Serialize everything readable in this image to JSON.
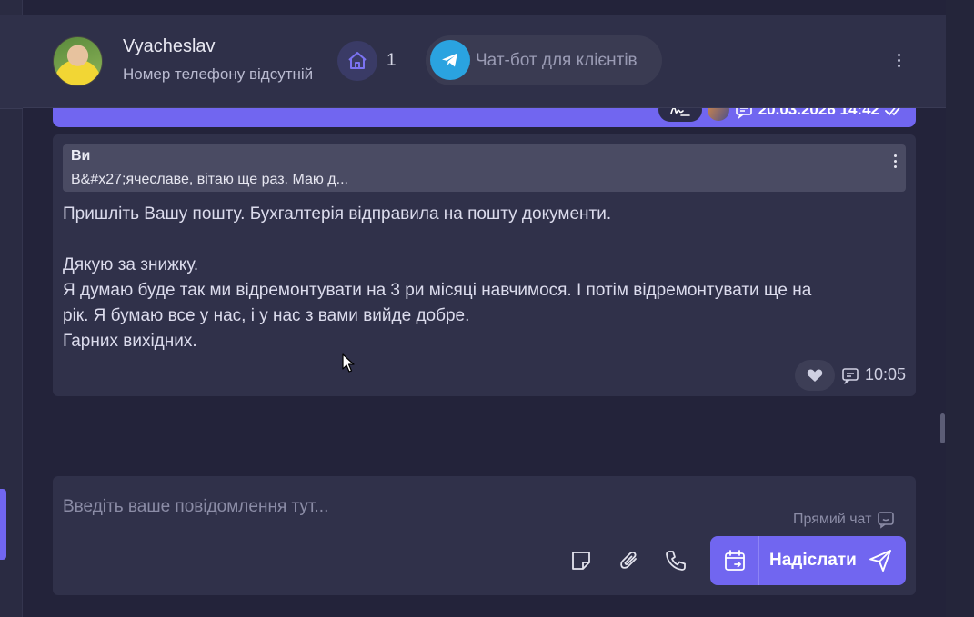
{
  "header": {
    "contact_name": "Vyacheslav",
    "contact_subtitle": "Номер телефону відсутній",
    "house_count": "1",
    "chatbot_label": "Чат-бот для клієнтів"
  },
  "previous_message": {
    "timestamp": "20.03.2026 14:42"
  },
  "message": {
    "quote_author": "Ви",
    "quote_text": "В&#x27;ячеславе, вітаю ще раз. Маю д...",
    "lines": [
      "Пришліть Вашу пошту. Бухгалтерія відправила на пошту документи.",
      "",
      "Дякую за знижку.",
      "Я думаю буде так ми відремонтувати на 3 ри місяці навчимося. І потім відремонтувати ще на",
      "рік. Я бумаю все у нас, і у нас з вами вийде добре.",
      "Гарних вихідних."
    ],
    "time": "10:05"
  },
  "composer": {
    "placeholder": "Введіть ваше повідомлення тут...",
    "direct_chat_label": "Прямий чат",
    "send_label": "Надіслати"
  },
  "colors": {
    "accent": "#7166f0",
    "telegram": "#2aa3e0",
    "background": "#23233a",
    "card": "#30314a"
  },
  "icons": [
    "home-icon",
    "telegram-icon",
    "more-vertical-icon",
    "signature-icon",
    "message-icon",
    "double-check-icon",
    "heart-icon",
    "sticky-note-icon",
    "paperclip-icon",
    "phone-icon",
    "calendar-schedule-icon",
    "send-icon"
  ]
}
